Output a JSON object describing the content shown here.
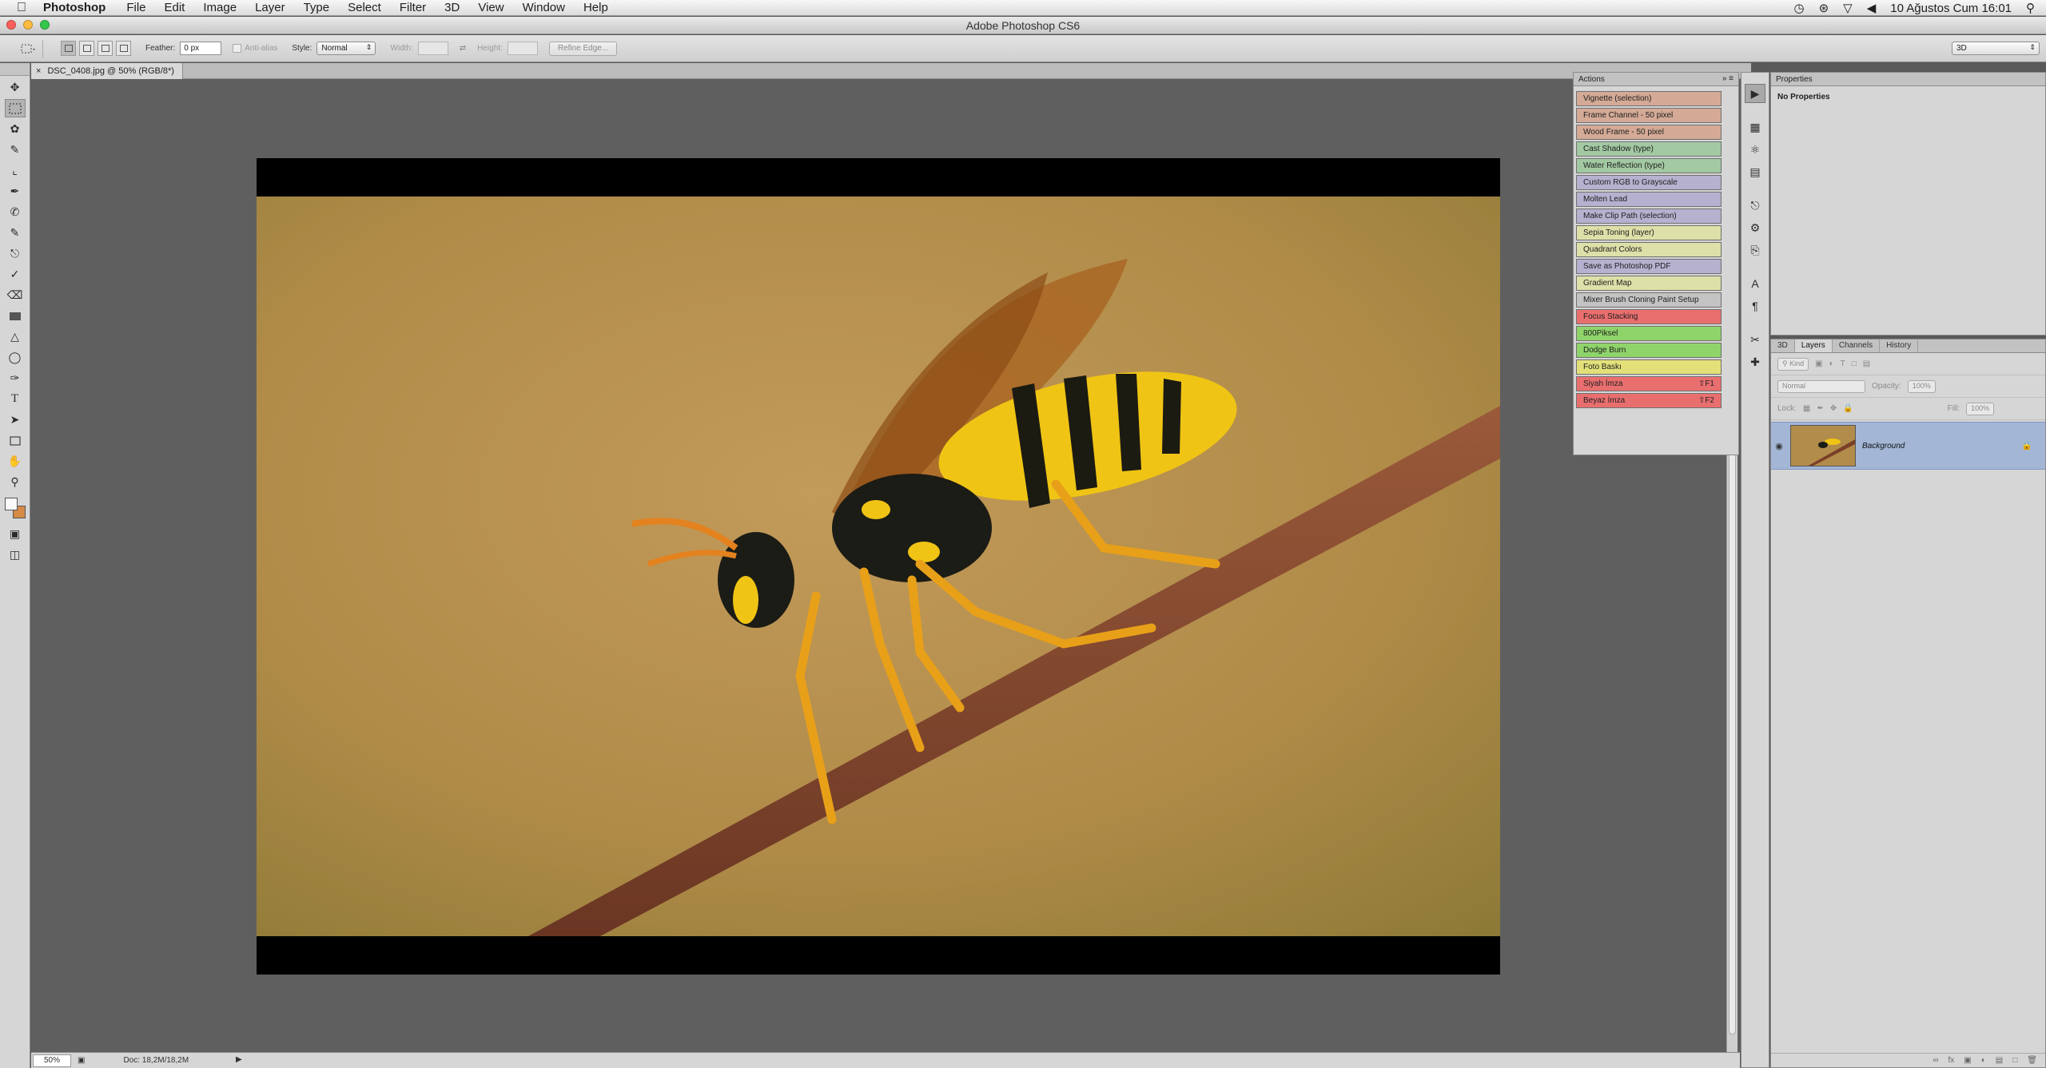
{
  "menubar": {
    "app_name": "Photoshop",
    "items": [
      "File",
      "Edit",
      "Image",
      "Layer",
      "Type",
      "Select",
      "Filter",
      "3D",
      "View",
      "Window",
      "Help"
    ],
    "datetime": "10 Ağustos Cum 16:01"
  },
  "window": {
    "title": "Adobe Photoshop CS6"
  },
  "options": {
    "feather_label": "Feather:",
    "feather_value": "0 px",
    "antialias_label": "Anti-alias",
    "style_label": "Style:",
    "style_value": "Normal",
    "width_label": "Width:",
    "height_label": "Height:",
    "refine_edge": "Refine Edge...",
    "workspace": "3D"
  },
  "document": {
    "tab_label": "DSC_0408.jpg @ 50% (RGB/8*)",
    "zoom": "50%",
    "doc_info": "Doc: 18,2M/18,2M"
  },
  "actions_panel": {
    "title": "Actions",
    "items": [
      {
        "label": "Vignette (selection)",
        "color": "#d4aa96",
        "key": ""
      },
      {
        "label": "Frame Channel - 50 pixel",
        "color": "#d4aa96",
        "key": ""
      },
      {
        "label": "Wood Frame - 50 pixel",
        "color": "#d4aa96",
        "key": ""
      },
      {
        "label": "Cast Shadow (type)",
        "color": "#a3c9a3",
        "key": ""
      },
      {
        "label": "Water Reflection (type)",
        "color": "#a3c9a3",
        "key": ""
      },
      {
        "label": "Custom RGB to Grayscale",
        "color": "#b6b1cf",
        "key": ""
      },
      {
        "label": "Molten Lead",
        "color": "#b6b1cf",
        "key": ""
      },
      {
        "label": "Make Clip Path (selection)",
        "color": "#b6b1cf",
        "key": ""
      },
      {
        "label": "Sepia Toning (layer)",
        "color": "#dde0a8",
        "key": ""
      },
      {
        "label": "Quadrant Colors",
        "color": "#dde0a8",
        "key": ""
      },
      {
        "label": "Save as Photoshop PDF",
        "color": "#b6b1cf",
        "key": ""
      },
      {
        "label": "Gradient Map",
        "color": "#dde0a8",
        "key": ""
      },
      {
        "label": "Mixer Brush Cloning Paint Setup",
        "color": "#c3c3c3",
        "key": ""
      },
      {
        "label": "Focus Stacking",
        "color": "#e96f6f",
        "key": ""
      },
      {
        "label": "800Piksel",
        "color": "#8fd46b",
        "key": ""
      },
      {
        "label": "Dodge Burn",
        "color": "#8fd46b",
        "key": ""
      },
      {
        "label": "Foto Baskı",
        "color": "#e3e07a",
        "key": ""
      },
      {
        "label": "Siyah İmza",
        "color": "#e96f6f",
        "key": "⇧F1"
      },
      {
        "label": "Beyaz İmza",
        "color": "#e96f6f",
        "key": "⇧F2"
      }
    ]
  },
  "properties_panel": {
    "title": "Properties",
    "body": "No Properties"
  },
  "layers_panel": {
    "tabs": [
      "3D",
      "Layers",
      "Channels",
      "History"
    ],
    "kind_label": "Kind",
    "blend_mode": "Normal",
    "opacity_label": "Opacity:",
    "opacity_value": "100%",
    "lock_label": "Lock:",
    "fill_label": "Fill:",
    "fill_value": "100%",
    "layer_name": "Background"
  }
}
